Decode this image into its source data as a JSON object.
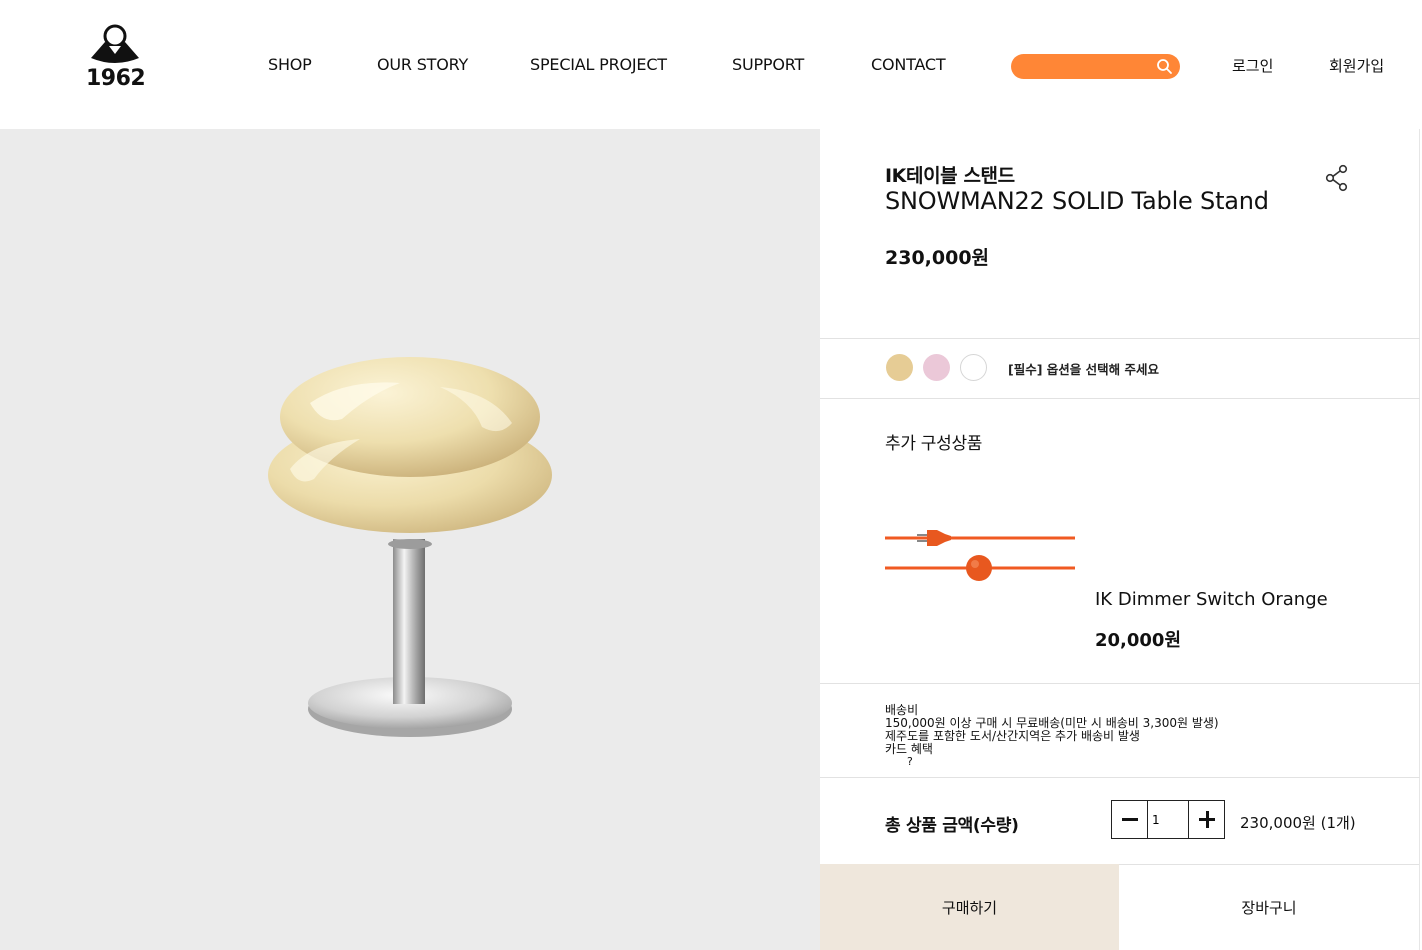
{
  "header": {
    "logo_text": "1962",
    "nav": [
      {
        "label": "SHOP"
      },
      {
        "label": "OUR STORY"
      },
      {
        "label": "SPECIAL PROJECT"
      },
      {
        "label": "SUPPORT"
      },
      {
        "label": "CONTACT"
      }
    ],
    "search": {
      "placeholder": "",
      "color": "#ff8636",
      "icon": "search-icon"
    },
    "login_label": "로그인",
    "signup_label": "회원가입"
  },
  "product": {
    "brand_name": "IK테이블 스탠드",
    "name": "SNOWMAN22 SOLID Table Stand",
    "price": "230,000원",
    "image_background": "#ebebeb",
    "options": {
      "swatches": [
        {
          "color": "#e6cc95"
        },
        {
          "color": "#ebc8d8"
        },
        {
          "color": "#ffffff"
        }
      ],
      "label": "[필수] 옵션을 선택해 주세요"
    }
  },
  "addon": {
    "title": "추가 구성상품",
    "item_name": "IK Dimmer Switch Orange",
    "item_price": "20,000원",
    "cable_color": "#f05a22"
  },
  "shipping": {
    "lines": [
      "배송비",
      "150,000원 이상 구매 시 무료배송(미만 시 배송비 3,300원 발생)",
      "제주도를 포함한 도서/산간지역은 추가 배송비 발생",
      "카드 혜택"
    ],
    "help_mark": "?"
  },
  "order": {
    "total_label": "총 상품 금액(수량)",
    "quantity": "1",
    "total_value": "230,000원 (1개)",
    "buy_label": "구매하기",
    "cart_label": "장바구니",
    "buy_color": "#efe7dc"
  }
}
